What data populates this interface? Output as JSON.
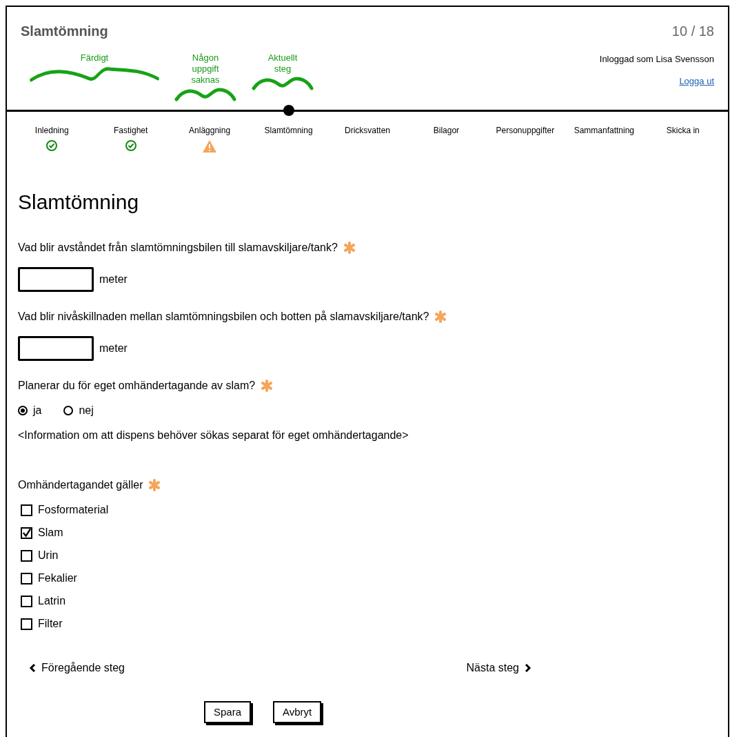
{
  "header": {
    "title": "Slamtömning",
    "page_counter": "10 / 18"
  },
  "annotations": [
    {
      "label": "Färdigt",
      "kind": "wide"
    },
    {
      "label": "Någon uppgift saknas",
      "kind": "narrow"
    },
    {
      "label": "Aktuellt steg",
      "kind": "narrow"
    }
  ],
  "user": {
    "logged_in_as": "Inloggad som Lisa Svensson",
    "logout_link": "Logga ut"
  },
  "steps": [
    {
      "label": "Inledning",
      "done": true,
      "warning": false,
      "current": false
    },
    {
      "label": "Fastighet",
      "done": true,
      "warning": false,
      "current": false
    },
    {
      "label": "Anläggning",
      "done": false,
      "warning": true,
      "current": false
    },
    {
      "label": "Slamtömning",
      "done": false,
      "warning": false,
      "current": true
    },
    {
      "label": "Dricksvatten",
      "done": false,
      "warning": false,
      "current": false
    },
    {
      "label": "Bilagor",
      "done": false,
      "warning": false,
      "current": false
    },
    {
      "label": "Personuppgifter",
      "done": false,
      "warning": false,
      "current": false
    },
    {
      "label": "Sammanfattning",
      "done": false,
      "warning": false,
      "current": false
    },
    {
      "label": "Skicka in",
      "done": false,
      "warning": false,
      "current": false
    }
  ],
  "heading": "Slamtömning",
  "questions": [
    {
      "kind": "number",
      "label": "Vad blir avståndet från slamtömningsbilen till slamavskiljare/tank?",
      "required": true,
      "unit": "meter"
    },
    {
      "kind": "number",
      "label": "Vad blir nivåskillnaden mellan slamtömningsbilen och botten på slamavskiljare/tank?",
      "required": true,
      "unit": "meter"
    },
    {
      "kind": "radio",
      "label": "Planerar du för eget omhändertagande av slam?",
      "required": true,
      "options": [
        {
          "label": "ja",
          "selected": true
        },
        {
          "label": "nej",
          "selected": false
        }
      ],
      "note": "<Information om att dispens behöver sökas separat för eget omhändertagande>"
    },
    {
      "kind": "checkbox",
      "label": "Omhändertagandet gäller",
      "required": true,
      "options": [
        {
          "label": "Fosformaterial",
          "checked": false
        },
        {
          "label": "Slam",
          "checked": true
        },
        {
          "label": "Urin",
          "checked": false
        },
        {
          "label": "Fekalier",
          "checked": false
        },
        {
          "label": "Latrin",
          "checked": false
        },
        {
          "label": "Filter",
          "checked": false
        }
      ]
    }
  ],
  "navigation": {
    "previous": "Föregående steg",
    "next": "Nästa steg"
  },
  "buttons": [
    "Spara",
    "Avbryt"
  ]
}
